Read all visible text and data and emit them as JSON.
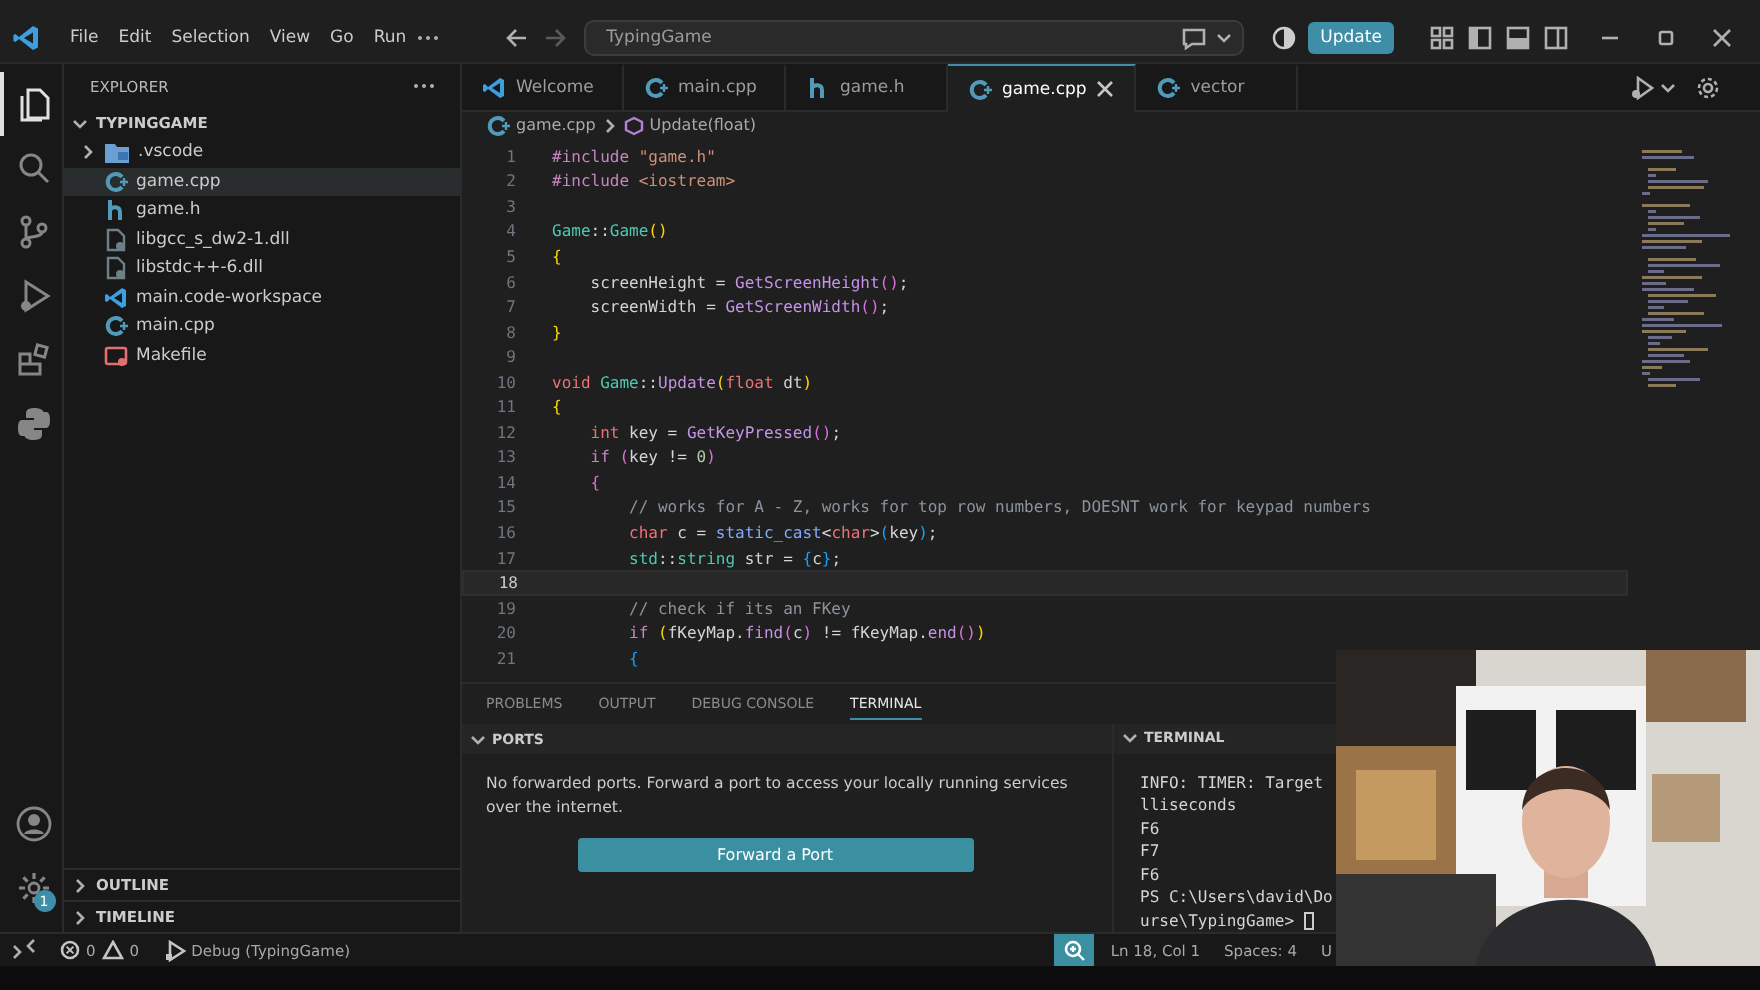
{
  "title_bar": {
    "menu": [
      "File",
      "Edit",
      "Selection",
      "View",
      "Go",
      "Run"
    ],
    "command_center": "TypingGame",
    "update_button": "Update"
  },
  "activity_bar": [
    {
      "kind": "files",
      "selected": true
    },
    {
      "kind": "search",
      "selected": false
    },
    {
      "kind": "scm",
      "selected": false
    },
    {
      "kind": "debug",
      "selected": false
    },
    {
      "kind": "extensions",
      "selected": false
    },
    {
      "kind": "python",
      "selected": false
    }
  ],
  "manage_badge": "1",
  "sidebar": {
    "title": "EXPLORER",
    "folder": {
      "name": "TYPINGGAME",
      "expanded": true,
      "children": [
        {
          "name": ".vscode",
          "kind": "folder",
          "expanded": false,
          "selected": false
        },
        {
          "name": "game.cpp",
          "kind": "cpp",
          "selected": true
        },
        {
          "name": "game.h",
          "kind": "h",
          "selected": false
        },
        {
          "name": "libgcc_s_dw2-1.dll",
          "kind": "dll",
          "selected": false
        },
        {
          "name": "libstdc++-6.dll",
          "kind": "dll",
          "selected": false
        },
        {
          "name": "main.code-workspace",
          "kind": "vscode",
          "selected": false
        },
        {
          "name": "main.cpp",
          "kind": "cpp",
          "selected": false
        },
        {
          "name": "Makefile",
          "kind": "make",
          "selected": false
        }
      ]
    },
    "sections": [
      {
        "name": "OUTLINE",
        "expanded": false
      },
      {
        "name": "TIMELINE",
        "expanded": false
      }
    ]
  },
  "tabs": [
    {
      "label": "Welcome",
      "kind": "vscode",
      "selected": false
    },
    {
      "label": "main.cpp",
      "kind": "cpp",
      "selected": false
    },
    {
      "label": "game.h",
      "kind": "h",
      "selected": false
    },
    {
      "label": "game.cpp",
      "kind": "cpp",
      "selected": true
    },
    {
      "label": "vector",
      "kind": "cpp",
      "selected": false
    }
  ],
  "breadcrumb": [
    "game.cpp",
    "Update(float)"
  ],
  "code": [
    {
      "n": "1",
      "current": false,
      "tokens": [
        {
          "kind": "directive",
          "text": "#include "
        },
        {
          "kind": "string",
          "text": "\"game.h\""
        }
      ]
    },
    {
      "n": "2",
      "current": false,
      "tokens": [
        {
          "kind": "directive",
          "text": "#include "
        },
        {
          "kind": "string",
          "text": "<iostream>"
        }
      ]
    },
    {
      "n": "3",
      "current": false
    },
    {
      "n": "4",
      "current": false,
      "tokens": [
        {
          "kind": "type",
          "text": "Game"
        },
        {
          "kind": "plain",
          "text": "::"
        },
        {
          "kind": "type",
          "text": "Game"
        },
        {
          "kind": "brace",
          "text": "()"
        }
      ]
    },
    {
      "n": "5",
      "current": false,
      "tokens": [
        {
          "kind": "brace",
          "text": "{"
        }
      ]
    },
    {
      "n": "6",
      "current": false,
      "tokens": [
        {
          "kind": "plain",
          "text": "    screenHeight = "
        },
        {
          "kind": "func",
          "text": "GetScreenHeight"
        },
        {
          "kind": "paren",
          "text": "()"
        },
        {
          "kind": "plain",
          "text": ";"
        }
      ]
    },
    {
      "n": "7",
      "current": false,
      "tokens": [
        {
          "kind": "plain",
          "text": "    screenWidth = "
        },
        {
          "kind": "func",
          "text": "GetScreenWidth"
        },
        {
          "kind": "paren",
          "text": "()"
        },
        {
          "kind": "plain",
          "text": ";"
        }
      ]
    },
    {
      "n": "8",
      "current": false,
      "tokens": [
        {
          "kind": "brace",
          "text": "}"
        }
      ]
    },
    {
      "n": "9",
      "current": false
    },
    {
      "n": "10",
      "current": false,
      "tokens": [
        {
          "kind": "keyword",
          "text": "void "
        },
        {
          "kind": "type",
          "text": "Game"
        },
        {
          "kind": "plain",
          "text": "::"
        },
        {
          "kind": "func",
          "text": "Update"
        },
        {
          "kind": "brace",
          "text": "("
        },
        {
          "kind": "keyword",
          "text": "float"
        },
        {
          "kind": "plain",
          "text": " dt"
        },
        {
          "kind": "brace",
          "text": ")"
        }
      ]
    },
    {
      "n": "11",
      "current": false,
      "tokens": [
        {
          "kind": "brace",
          "text": "{"
        }
      ]
    },
    {
      "n": "12",
      "current": false,
      "tokens": [
        {
          "kind": "keyword",
          "text": "    int"
        },
        {
          "kind": "plain",
          "text": " key = "
        },
        {
          "kind": "func",
          "text": "GetKeyPressed"
        },
        {
          "kind": "paren",
          "text": "()"
        },
        {
          "kind": "plain",
          "text": ";"
        }
      ]
    },
    {
      "n": "13",
      "current": false,
      "tokens": [
        {
          "kind": "control",
          "text": "    if "
        },
        {
          "kind": "paren",
          "text": "("
        },
        {
          "kind": "plain",
          "text": "key != "
        },
        {
          "kind": "number",
          "text": "0"
        },
        {
          "kind": "paren",
          "text": ")"
        }
      ]
    },
    {
      "n": "14",
      "current": false,
      "tokens": [
        {
          "kind": "paren",
          "text": "    {"
        }
      ]
    },
    {
      "n": "15",
      "current": false,
      "tokens": [
        {
          "kind": "comment",
          "text": "        // works for A - Z, works for top row numbers, DOESNT work for keypad numbers"
        }
      ]
    },
    {
      "n": "16",
      "current": false,
      "tokens": [
        {
          "kind": "keyword",
          "text": "        char"
        },
        {
          "kind": "plain",
          "text": " c = "
        },
        {
          "kind": "cast",
          "text": "static_cast"
        },
        {
          "kind": "plain",
          "text": "<"
        },
        {
          "kind": "keyword",
          "text": "char"
        },
        {
          "kind": "plain",
          "text": ">"
        },
        {
          "kind": "paren2",
          "text": "("
        },
        {
          "kind": "plain",
          "text": "key"
        },
        {
          "kind": "paren2",
          "text": ")"
        },
        {
          "kind": "plain",
          "text": ";"
        }
      ]
    },
    {
      "n": "17",
      "current": false,
      "tokens": [
        {
          "kind": "type",
          "text": "        std"
        },
        {
          "kind": "plain",
          "text": "::"
        },
        {
          "kind": "type",
          "text": "string"
        },
        {
          "kind": "plain",
          "text": " str = "
        },
        {
          "kind": "paren2",
          "text": "{"
        },
        {
          "kind": "plain",
          "text": "c"
        },
        {
          "kind": "paren2",
          "text": "}"
        },
        {
          "kind": "plain",
          "text": ";"
        }
      ]
    },
    {
      "n": "18",
      "current": true
    },
    {
      "n": "19",
      "current": false,
      "tokens": [
        {
          "kind": "comment",
          "text": "        // check if its an FKey"
        }
      ]
    },
    {
      "n": "20",
      "current": false,
      "tokens": [
        {
          "kind": "control",
          "text": "        if "
        },
        {
          "kind": "brace",
          "text": "("
        },
        {
          "kind": "plain",
          "text": "fKeyMap."
        },
        {
          "kind": "func",
          "text": "find"
        },
        {
          "kind": "paren",
          "text": "("
        },
        {
          "kind": "plain",
          "text": "c"
        },
        {
          "kind": "paren",
          "text": ")"
        },
        {
          "kind": "plain",
          "text": " != fKeyMap."
        },
        {
          "kind": "func",
          "text": "end"
        },
        {
          "kind": "paren",
          "text": "()"
        },
        {
          "kind": "brace",
          "text": ")"
        }
      ]
    },
    {
      "n": "21",
      "current": false,
      "tokens": [
        {
          "kind": "paren2",
          "text": "        {"
        }
      ]
    }
  ],
  "panel": {
    "tabs": [
      {
        "label": "PROBLEMS",
        "selected": false
      },
      {
        "label": "OUTPUT",
        "selected": false
      },
      {
        "label": "DEBUG CONSOLE",
        "selected": false
      },
      {
        "label": "TERMINAL",
        "selected": true
      }
    ],
    "ports": {
      "header": "PORTS",
      "expanded": true,
      "message": "No forwarded ports. Forward a port to access your locally running services over the internet.",
      "button": "Forward a Port"
    },
    "terminal": {
      "header": "TERMINAL",
      "expanded": true,
      "lines": [
        "INFO: TIMER: Target",
        "lliseconds",
        "F6",
        "F7",
        "F6",
        "PS C:\\Users\\david\\Do"
      ],
      "prompt": "urse\\TypingGame> "
    }
  },
  "status_bar": {
    "errors": "0",
    "warnings": "0",
    "debug": "Debug (TypingGame)",
    "right": [
      "Ln 18, Col 1",
      "Spaces: 4",
      "U"
    ]
  },
  "webcam": {
    "kind": "picture"
  }
}
